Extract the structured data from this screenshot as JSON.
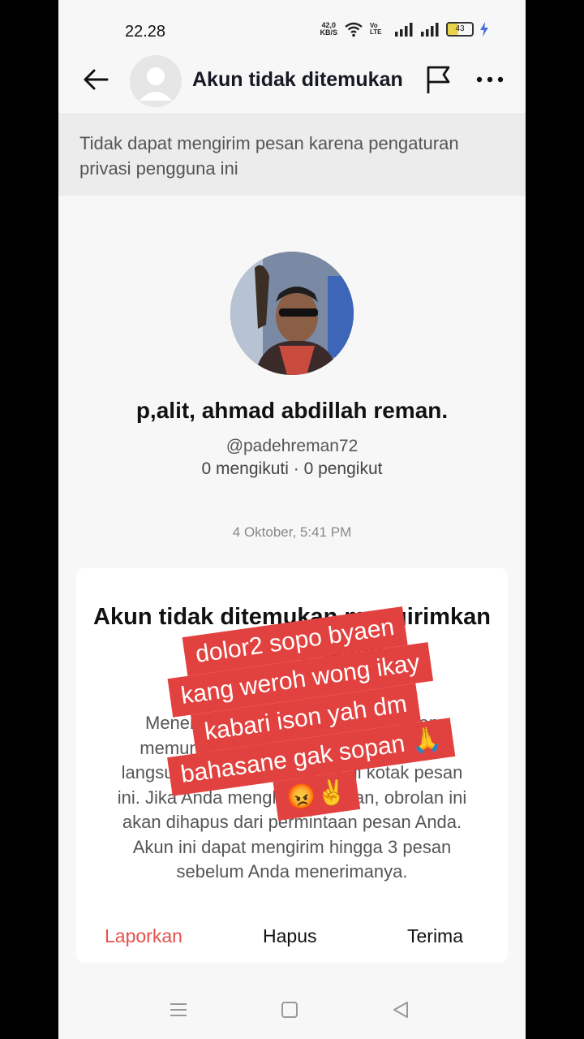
{
  "status_bar": {
    "time": "22.28",
    "net_speed_value": "42,0",
    "net_speed_unit": "KB/S",
    "volte": "Vo LTE",
    "battery": "43"
  },
  "header": {
    "title": "Akun tidak ditemukan",
    "icons": [
      "back-arrow-icon",
      "avatar-placeholder-icon",
      "flag-icon",
      "more-icon"
    ]
  },
  "privacy_notice": "Tidak dapat mengirim pesan karena pengaturan privasi pengguna ini",
  "profile": {
    "name": "p,alit, ahmad abdillah reman.",
    "username": "@padehreman72",
    "following_count": "0 mengikuti",
    "separator": " · ",
    "followers_count": "0 pengikut"
  },
  "message_timestamp": "4 Oktober, 5:41 PM",
  "request_card": {
    "title": "Akun tidak ditemukan mengirimkan pesan kepadaan",
    "body": "Menerima permintaan pesan ini akan memungkinkan Anda untuk mengobrol langsung dengan pengguna di kotak pesan ini. Jika Anda menghapus pesan, obrolan ini akan dihapus dari permintaan pesan Anda. Akun ini dapat mengirim hingga 3 pesan sebelum Anda menerimanya.",
    "actions": {
      "report": "Laporkan",
      "delete": "Hapus",
      "accept": "Terima"
    }
  },
  "overlay_caption": {
    "lines": [
      "dolor2 sopo byaen",
      "kang weroh wong ikay",
      "kabari ison yah dm",
      "bahasane gak sopan 🙏",
      "😡✌️"
    ]
  },
  "colors": {
    "accent_red": "#e5504a",
    "caption_bg": "#e2423f",
    "page_bg": "#f7f7f7",
    "notice_bg": "#ececec"
  },
  "nav_bar": {
    "icons": [
      "menu-icon",
      "home-square-icon",
      "back-triangle-icon"
    ]
  }
}
